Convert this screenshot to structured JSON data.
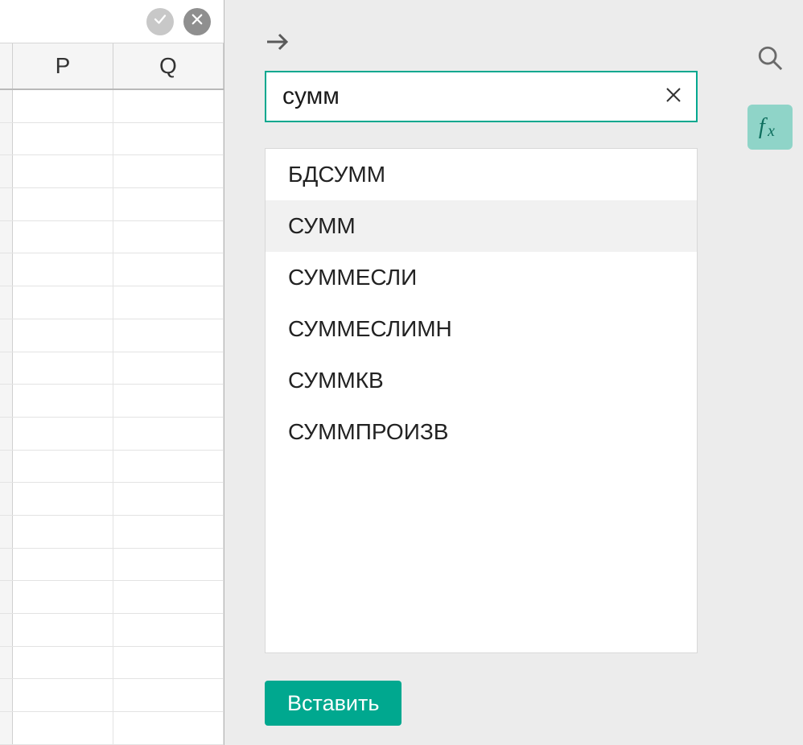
{
  "columns": {
    "p": "P",
    "q": "Q"
  },
  "search": {
    "value": "сумм"
  },
  "results": [
    {
      "label": "БДСУММ",
      "selected": false
    },
    {
      "label": "СУММ",
      "selected": true
    },
    {
      "label": "СУММЕСЛИ",
      "selected": false
    },
    {
      "label": "СУММЕСЛИМН",
      "selected": false
    },
    {
      "label": "СУММКВ",
      "selected": false
    },
    {
      "label": "СУММПРОИЗВ",
      "selected": false
    }
  ],
  "actions": {
    "insert": "Вставить"
  },
  "icons": {
    "confirm": "check",
    "cancel": "x",
    "collapse": "arrow-right",
    "clear": "x",
    "search": "magnifier",
    "fx": "fx"
  }
}
